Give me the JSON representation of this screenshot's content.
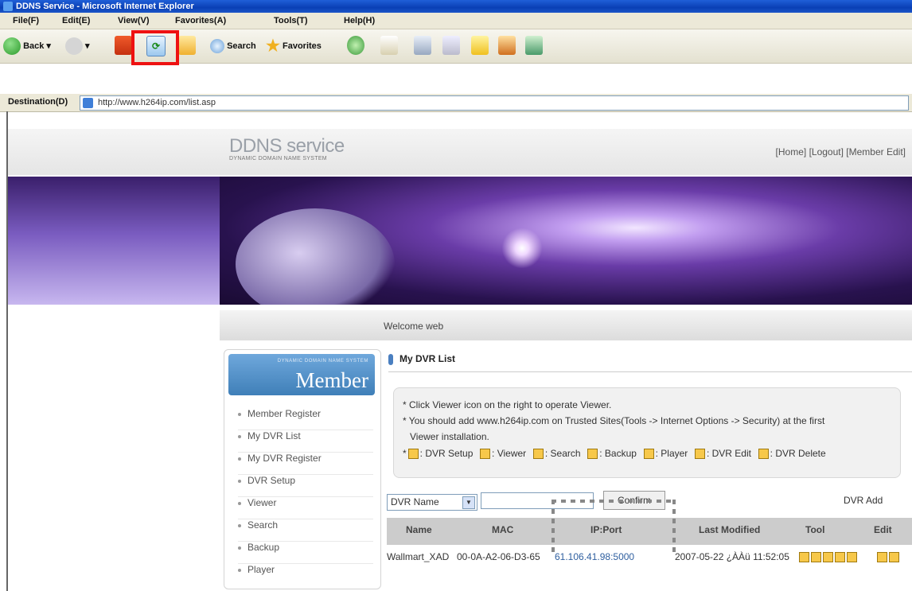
{
  "window": {
    "title": "DDNS Service - Microsoft Internet Explorer"
  },
  "menu": {
    "items": [
      "File(F)",
      "Edit(E)",
      "View(V)",
      "Favorites(A)",
      "Tools(T)",
      "Help(H)"
    ]
  },
  "toolbar": {
    "back_label": "Back",
    "search_label": "Search",
    "favorites_label": "Favorites"
  },
  "address": {
    "label": "Destination(D)",
    "url": "http://www.h264ip.com/list.asp"
  },
  "header": {
    "logo_title": "DDNS service",
    "logo_subtitle": "DYNAMIC DOMAIN NAME SYSTEM",
    "links": {
      "home": "[Home]",
      "logout": "[Logout]",
      "member_edit": "[Member Edit]"
    }
  },
  "welcome": "Welcome web",
  "sidebar": {
    "small_caption": "DYNAMIC DOMAIN NAME SYSTEM",
    "heading": "Member",
    "items": [
      "Member Register",
      "My DVR List",
      "My DVR Register",
      "DVR Setup",
      "Viewer",
      "Search",
      "Backup",
      "Player"
    ]
  },
  "main": {
    "title": "My DVR List",
    "info_lines": [
      "* Click Viewer icon on the right to operate Viewer.",
      "* You should add www.h264ip.com on Trusted Sites(Tools -> Internet Options -> Security) at the first",
      "Viewer installation."
    ],
    "legend": {
      "star": "*",
      "setup": ": DVR Setup",
      "viewer": ": Viewer",
      "search": ": Search",
      "backup": ": Backup",
      "player": ": Player",
      "edit": ": DVR Edit",
      "delete": ": DVR Delete"
    },
    "filter": {
      "select_value": "DVR Name",
      "input_value": "",
      "confirm_label": "Confirm",
      "add_label": "DVR Add"
    },
    "table": {
      "headers": [
        "Name",
        "MAC",
        "IP:Port",
        "Last Modified",
        "Tool",
        "Edit"
      ],
      "rows": [
        {
          "name": "Wallmart_XAD",
          "mac": "00-0A-A2-06-D3-65",
          "ip": "61.106.41.98:5000",
          "modified": "2007-05-22 ¿ÀÀü 11:52:05"
        }
      ]
    }
  },
  "colors": {
    "accent": "#4a7fc0",
    "highlight": "#e11111",
    "banner": "#6a3ca8"
  }
}
